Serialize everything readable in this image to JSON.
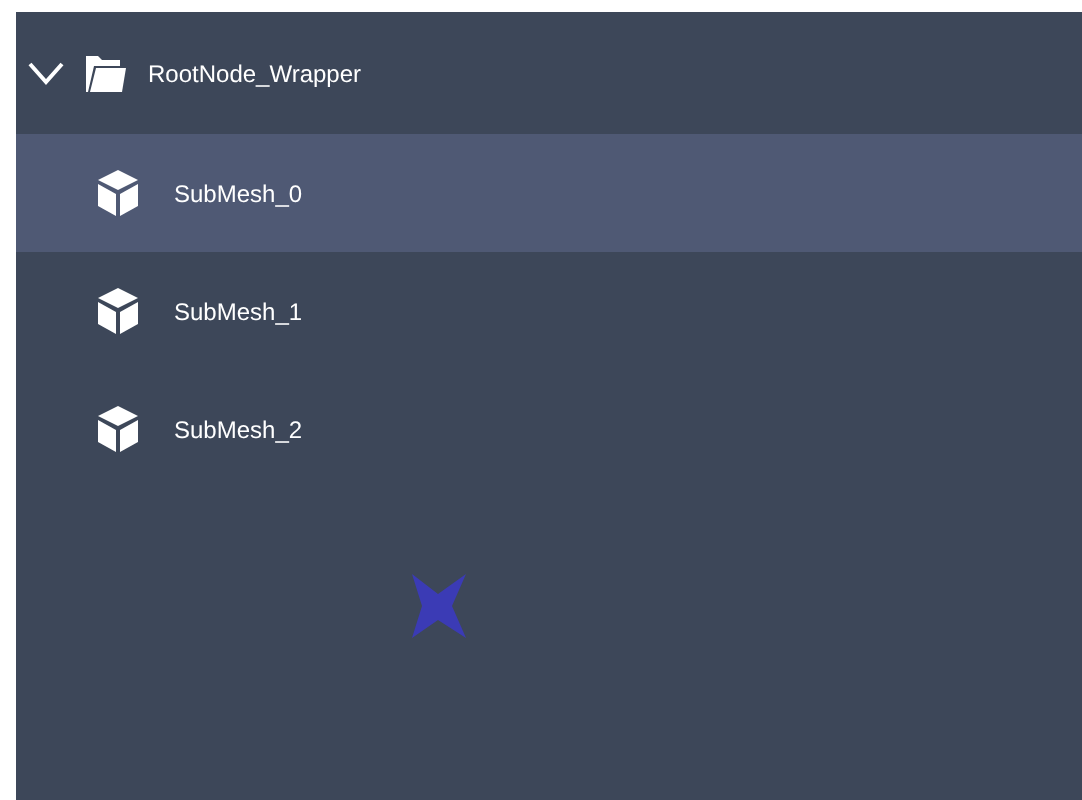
{
  "tree": {
    "label": "RootNode_Wrapper",
    "expanded": true,
    "children": [
      {
        "label": "SubMesh_0",
        "selected": true
      },
      {
        "label": "SubMesh_1",
        "selected": false
      },
      {
        "label": "SubMesh_2",
        "selected": false
      }
    ]
  }
}
